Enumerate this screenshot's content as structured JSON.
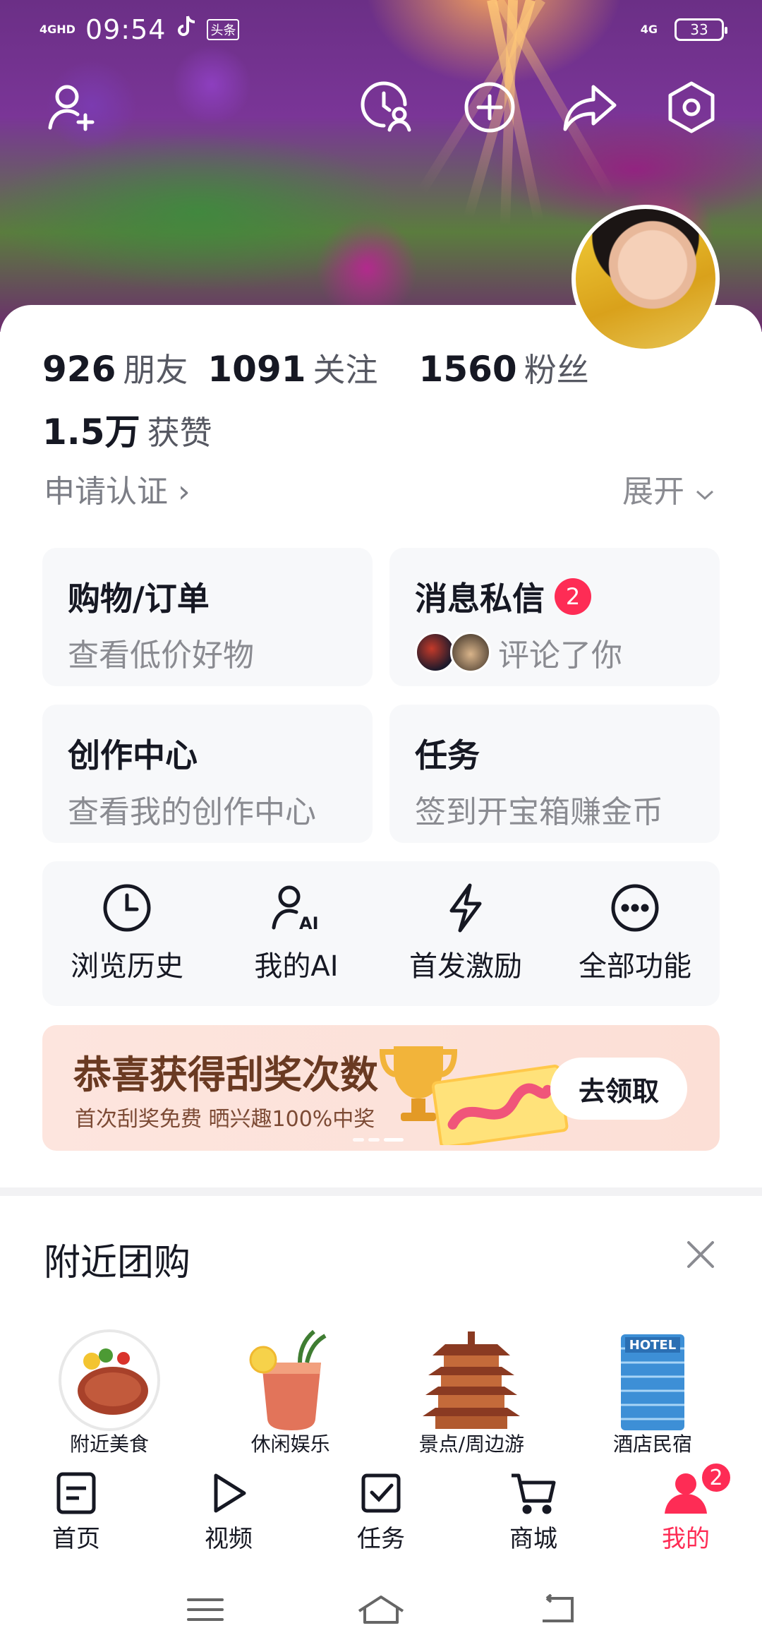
{
  "status_bar": {
    "network": "4GHD",
    "time": "09:54",
    "app_badge": "头条",
    "signal_right": "4G",
    "battery": "33"
  },
  "stats": {
    "friends_count": "926",
    "friends_label": "朋友",
    "following_count": "1091",
    "following_label": "关注",
    "followers_count": "1560",
    "followers_label": "粉丝",
    "likes_count": "1.5万",
    "likes_label": "获赞"
  },
  "verify_link": "申请认证 ›",
  "expand_label": "展开",
  "tiles": {
    "shopping": {
      "title": "购物/订单",
      "sub": "查看低价好物"
    },
    "messages": {
      "title": "消息私信",
      "badge": "2",
      "sub": "评论了你"
    },
    "creator": {
      "title": "创作中心",
      "sub": "查看我的创作中心"
    },
    "tasks": {
      "title": "任务",
      "sub": "签到开宝箱赚金币"
    }
  },
  "quick_actions": [
    {
      "label": "浏览历史",
      "icon": "clock-icon"
    },
    {
      "label": "我的AI",
      "icon": "ai-user-icon"
    },
    {
      "label": "首发激励",
      "icon": "lightning-icon"
    },
    {
      "label": "全部功能",
      "icon": "more-dots-icon"
    }
  ],
  "promo": {
    "title": "恭喜获得刮奖次数",
    "subtitle": "首次刮奖免费 晒兴趣100%中奖",
    "button": "去领取"
  },
  "nearby": {
    "title": "附近团购",
    "items": [
      {
        "label": "附近美食",
        "icon": "steak-plate-icon"
      },
      {
        "label": "休闲娱乐",
        "icon": "cocktail-icon"
      },
      {
        "label": "景点/周边游",
        "icon": "pagoda-icon"
      },
      {
        "label": "酒店民宿",
        "icon": "hotel-building-icon"
      }
    ]
  },
  "tabbar": [
    {
      "label": "首页",
      "icon": "home-doc-icon"
    },
    {
      "label": "视频",
      "icon": "play-icon"
    },
    {
      "label": "任务",
      "icon": "task-check-icon"
    },
    {
      "label": "商城",
      "icon": "cart-icon"
    },
    {
      "label": "我的",
      "icon": "profile-icon",
      "badge": "2",
      "active": true
    }
  ],
  "colors": {
    "accent": "#fe2c55",
    "text": "#161823",
    "muted": "#8a8b91",
    "tile_bg": "#f7f8fa",
    "promo_bg": "#fde5de"
  }
}
